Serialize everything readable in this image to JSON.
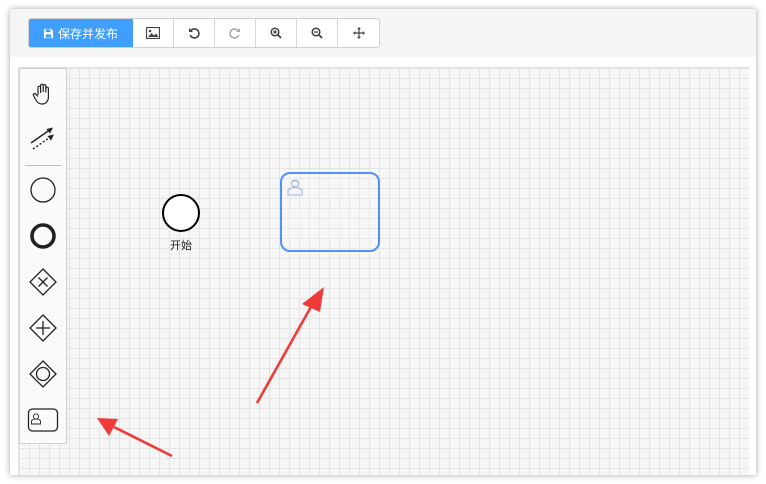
{
  "toolbar": {
    "save_publish_label": "保存并发布",
    "buttons": [
      {
        "icon": "image-icon"
      },
      {
        "icon": "undo-icon"
      },
      {
        "icon": "redo-icon"
      },
      {
        "icon": "zoom-in-icon"
      },
      {
        "icon": "zoom-out-icon"
      },
      {
        "icon": "move-icon"
      }
    ]
  },
  "palette": {
    "tools": [
      "hand-tool-icon",
      "connect-tool-icon",
      "start-event-icon",
      "end-event-icon",
      "exclusive-gateway-icon",
      "parallel-gateway-icon",
      "inclusive-gateway-icon",
      "user-task-icon"
    ]
  },
  "diagram": {
    "start_event_label": "开始"
  },
  "colors": {
    "primary": "#409eff",
    "selection": "#4d90fe",
    "annotation_arrow": "#f03a3a"
  }
}
